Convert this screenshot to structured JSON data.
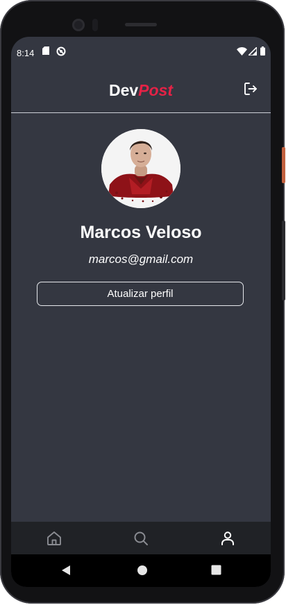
{
  "status": {
    "time": "8:14"
  },
  "app": {
    "logo_dev": "Dev",
    "logo_post": "Post"
  },
  "profile": {
    "name": "Marcos Veloso",
    "email": "marcos@gmail.com",
    "update_button": "Atualizar perfil"
  },
  "tabs": [
    "home",
    "search",
    "profile"
  ],
  "active_tab": "profile",
  "colors": {
    "background": "#343741",
    "accent": "#e52246",
    "tabbar": "#202226",
    "active_icon": "#ffffff",
    "inactive_icon": "#8a8c92"
  }
}
